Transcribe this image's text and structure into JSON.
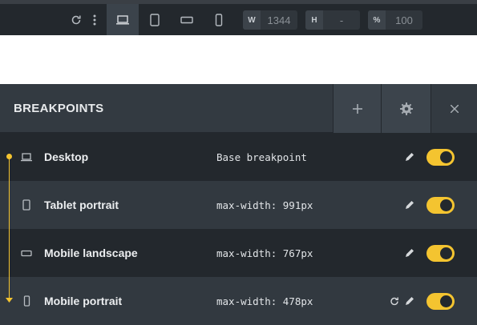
{
  "toolbar": {
    "buttons": [
      {
        "name": "reload-icon"
      },
      {
        "name": "more-vertical-icon"
      },
      {
        "name": "desktop-icon",
        "active": true
      },
      {
        "name": "tablet-portrait-icon"
      },
      {
        "name": "mobile-landscape-icon"
      },
      {
        "name": "mobile-portrait-icon"
      }
    ],
    "width": {
      "label": "W",
      "value": "1344"
    },
    "height": {
      "label": "H",
      "value": "-"
    },
    "zoom": {
      "label": "%",
      "value": "100"
    }
  },
  "panel": {
    "title": "BREAKPOINTS",
    "add_icon": "plus-icon",
    "settings_icon": "gear-icon",
    "close_icon": "close-icon",
    "rows": [
      {
        "icon": "desktop-icon",
        "name": "Desktop",
        "desc": "Base breakpoint",
        "enabled": true,
        "reset": false
      },
      {
        "icon": "tablet-portrait-icon",
        "name": "Tablet portrait",
        "desc": "max-width: 991px",
        "enabled": true,
        "reset": false
      },
      {
        "icon": "mobile-landscape-icon",
        "name": "Mobile landscape",
        "desc": "max-width: 767px",
        "enabled": true,
        "reset": false
      },
      {
        "icon": "mobile-portrait-icon",
        "name": "Mobile portrait",
        "desc": "max-width: 478px",
        "enabled": true,
        "reset": true
      }
    ]
  },
  "colors": {
    "accent": "#f4c430",
    "panel_bg": "#2b3036",
    "toolbar_bg": "#23282d"
  }
}
